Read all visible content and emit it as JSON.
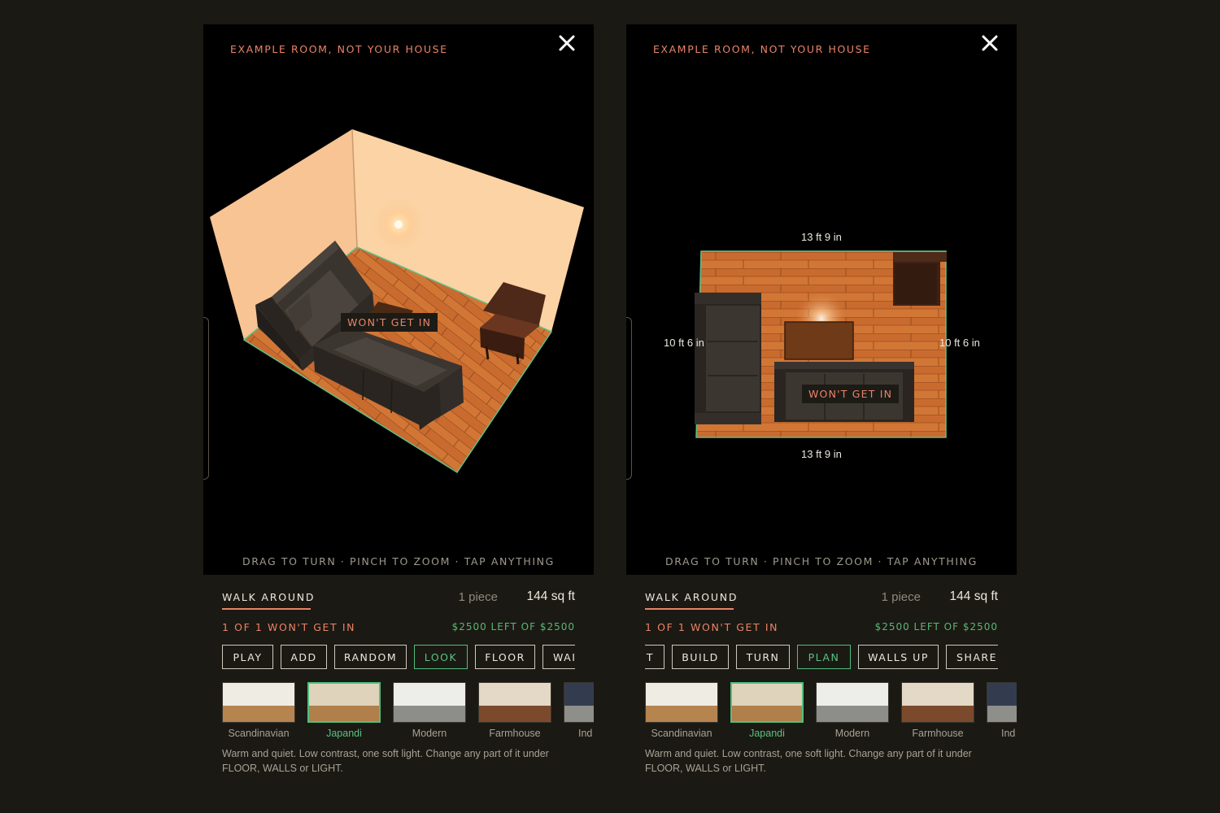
{
  "colors": {
    "accent_coral": "#e98368",
    "accent_green": "#58c283",
    "page_bg": "#1b1913",
    "wall": "#f8c898",
    "floor": "#c86a30"
  },
  "panels": [
    {
      "id": "left",
      "view_mode": "3d",
      "viewport": {
        "label": "EXAMPLE ROOM, NOT YOUR HOUSE",
        "close_icon": "close-icon",
        "warning_tag": "WON'T GET IN",
        "hint": "DRAG TO TURN · PINCH TO ZOOM · TAP ANYTHING"
      },
      "status": {
        "title": "WALK AROUND",
        "pieces": "1 piece",
        "area": "144 sq ft",
        "warning": "1 OF 1 WON'T GET IN",
        "budget": "$2500 LEFT OF $2500"
      },
      "buttons": [
        {
          "label": "PLAY",
          "active": false
        },
        {
          "label": "ADD",
          "active": false
        },
        {
          "label": "RANDOM",
          "active": false
        },
        {
          "label": "LOOK",
          "active": true
        },
        {
          "label": "FLOOR",
          "active": false
        },
        {
          "label": "WAI",
          "active": false
        }
      ],
      "styles": [
        {
          "name": "Scandinavian",
          "top": "#efece4",
          "bottom": "#b6844f",
          "selected": false
        },
        {
          "name": "Japandi",
          "top": "#dfd3bb",
          "bottom": "#b07f4a",
          "selected": true
        },
        {
          "name": "Modern",
          "top": "#ededea",
          "bottom": "#8d8d89",
          "selected": false
        },
        {
          "name": "Farmhouse",
          "top": "#e3d9c6",
          "bottom": "#7b4a2c",
          "selected": false
        },
        {
          "name": "Ind",
          "top": "#333c4f",
          "bottom": "#8e8e8a",
          "selected": false
        }
      ],
      "description": "Warm and quiet. Low contrast, one soft light. Change any part of it under FLOOR, WALLS or LIGHT."
    },
    {
      "id": "right",
      "view_mode": "plan",
      "viewport": {
        "label": "EXAMPLE ROOM, NOT YOUR HOUSE",
        "close_icon": "close-icon",
        "warning_tag": "WON'T GET IN",
        "hint": "DRAG TO TURN · PINCH TO ZOOM · TAP ANYTHING",
        "dimensions": {
          "top": "13 ft 9 in",
          "bottom": "13 ft 9 in",
          "left": "10 ft 6 in",
          "right": "10 ft 6 in"
        }
      },
      "status": {
        "title": "WALK AROUND",
        "pieces": "1 piece",
        "area": "144 sq ft",
        "warning": "1 OF 1 WON'T GET IN",
        "budget": "$2500 LEFT OF $2500"
      },
      "buttons": [
        {
          "label": "T",
          "active": false
        },
        {
          "label": "BUILD",
          "active": false
        },
        {
          "label": "TURN",
          "active": false
        },
        {
          "label": "PLAN",
          "active": true
        },
        {
          "label": "WALLS UP",
          "active": false
        },
        {
          "label": "SHARE",
          "active": false
        }
      ],
      "styles": [
        {
          "name": "Scandinavian",
          "top": "#efece4",
          "bottom": "#b6844f",
          "selected": false
        },
        {
          "name": "Japandi",
          "top": "#dfd3bb",
          "bottom": "#b07f4a",
          "selected": true
        },
        {
          "name": "Modern",
          "top": "#ededea",
          "bottom": "#8d8d89",
          "selected": false
        },
        {
          "name": "Farmhouse",
          "top": "#e3d9c6",
          "bottom": "#7b4a2c",
          "selected": false
        },
        {
          "name": "Ind",
          "top": "#333c4f",
          "bottom": "#8e8e8a",
          "selected": false
        }
      ],
      "description": "Warm and quiet. Low contrast, one soft light. Change any part of it under FLOOR, WALLS or LIGHT."
    }
  ]
}
